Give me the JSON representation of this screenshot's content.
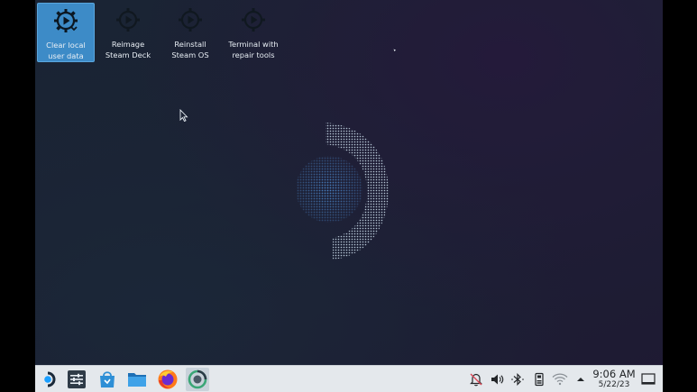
{
  "desktop": {
    "icons": [
      {
        "label": "Clear local user data",
        "icon": "recovery-gear-icon",
        "selected": true
      },
      {
        "label": "Reimage Steam Deck",
        "icon": "recovery-gear-icon",
        "selected": false
      },
      {
        "label": "Reinstall Steam OS",
        "icon": "recovery-gear-icon",
        "selected": false
      },
      {
        "label": "Terminal with repair tools",
        "icon": "recovery-gear-icon",
        "selected": false
      }
    ],
    "wallpaper": "steam-deck-logo-icon"
  },
  "taskbar": {
    "launchers": [
      {
        "icon": "steam-deck-logo-icon"
      },
      {
        "icon": "system-settings-icon"
      },
      {
        "icon": "discover-store-icon"
      },
      {
        "icon": "file-manager-icon"
      },
      {
        "icon": "firefox-icon"
      },
      {
        "icon": "recovery-tool-icon",
        "active": true
      }
    ],
    "tray": [
      {
        "icon": "notifications-muted-icon"
      },
      {
        "icon": "volume-icon"
      },
      {
        "icon": "bluetooth-icon"
      },
      {
        "icon": "storage-icon"
      },
      {
        "icon": "wifi-icon"
      },
      {
        "icon": "tray-expand-icon"
      }
    ],
    "clock": {
      "time": "9:06 AM",
      "date": "5/22/23"
    },
    "show_desktop_icon": "show-desktop-icon"
  },
  "colors": {
    "accent": "#3d8bc7",
    "panel": "#e4e8ec",
    "desktop": "#1b2233"
  }
}
